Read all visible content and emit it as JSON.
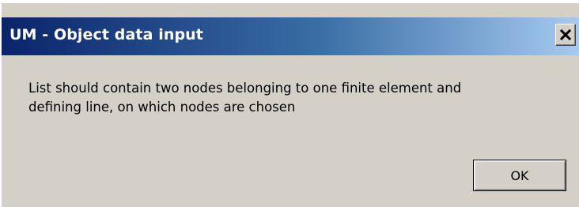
{
  "window": {
    "title": "UM - Object data input",
    "close_icon": "close-icon"
  },
  "message": {
    "line1": "List should contain two nodes belonging to one finite element and",
    "line2": "defining line, on which nodes are chosen"
  },
  "buttons": {
    "ok_label": "OK"
  },
  "colors": {
    "titlebar_start": "#0a246a",
    "titlebar_end": "#a6caf0",
    "dialog_background": "#d4d0c8"
  }
}
